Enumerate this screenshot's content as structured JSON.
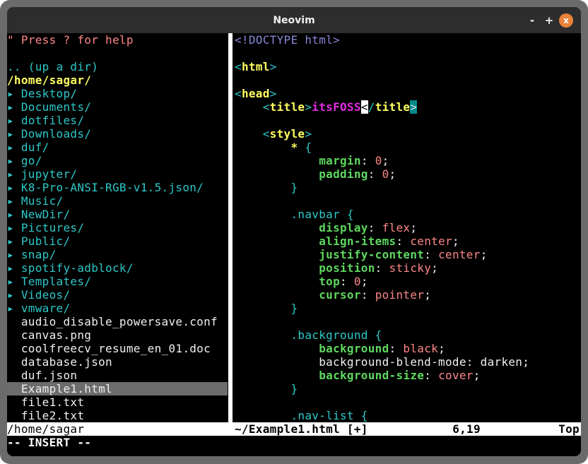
{
  "window": {
    "title": "Neovim",
    "buttons": {
      "minimize": "-",
      "maximize": "+",
      "close": "x"
    },
    "close_color": "#e9823a"
  },
  "tree": {
    "rows": [
      {
        "t": "\" Press ? for help",
        "c": "pink"
      },
      {
        "t": "",
        "c": "plain"
      },
      {
        "t": ".. (up a dir)",
        "c": "cyan"
      },
      {
        "t": "/home/sagar/",
        "c": "yellow"
      },
      {
        "t": "▸ Desktop/",
        "c": "cyan"
      },
      {
        "t": "▸ Documents/",
        "c": "cyan"
      },
      {
        "t": "▸ dotfiles/",
        "c": "cyan"
      },
      {
        "t": "▸ Downloads/",
        "c": "cyan"
      },
      {
        "t": "▸ duf/",
        "c": "cyan"
      },
      {
        "t": "▸ go/",
        "c": "cyan"
      },
      {
        "t": "▸ jupyter/",
        "c": "cyan"
      },
      {
        "t": "▸ K8-Pro-ANSI-RGB-v1.5.json/",
        "c": "cyan"
      },
      {
        "t": "▸ Music/",
        "c": "cyan"
      },
      {
        "t": "▸ NewDir/",
        "c": "cyan"
      },
      {
        "t": "▸ Pictures/",
        "c": "cyan"
      },
      {
        "t": "▸ Public/",
        "c": "cyan"
      },
      {
        "t": "▸ snap/",
        "c": "cyan"
      },
      {
        "t": "▸ spotify-adblock/",
        "c": "cyan"
      },
      {
        "t": "▸ Templates/",
        "c": "cyan"
      },
      {
        "t": "▸ Videos/",
        "c": "cyan"
      },
      {
        "t": "▸ vmware/",
        "c": "cyan"
      },
      {
        "t": "  audio_disable_powersave.conf",
        "c": "white"
      },
      {
        "t": "  canvas.png",
        "c": "white"
      },
      {
        "t": "  coolfreecv_resume_en_01.doc",
        "c": "white"
      },
      {
        "t": "  database.json",
        "c": "white"
      },
      {
        "t": "  duf.json",
        "c": "white"
      },
      {
        "t": "  Example1.html",
        "c": "white",
        "selected": true
      },
      {
        "t": "  file1.txt",
        "c": "white"
      },
      {
        "t": "  file2.txt",
        "c": "white"
      }
    ]
  },
  "editor": {
    "lines": [
      [
        {
          "t": "<!DOCTYPE html>",
          "c": "blue"
        }
      ],
      [],
      [
        {
          "t": "<",
          "c": "cyan"
        },
        {
          "t": "html",
          "c": "ytag"
        },
        {
          "t": ">",
          "c": "cyan"
        }
      ],
      [],
      [
        {
          "t": "<",
          "c": "cyan"
        },
        {
          "t": "head",
          "c": "ytag"
        },
        {
          "t": ">",
          "c": "cyan"
        }
      ],
      [
        {
          "t": "    ",
          "c": "plain"
        },
        {
          "t": "<",
          "c": "cyan"
        },
        {
          "t": "title",
          "c": "ytag"
        },
        {
          "t": ">",
          "c": "cyan"
        },
        {
          "t": "itsFOSS",
          "c": "mag"
        },
        {
          "t": "<",
          "c": "cyan",
          "b": "cur"
        },
        {
          "t": "/",
          "c": "cyan"
        },
        {
          "t": "title",
          "c": "ytag"
        },
        {
          "t": ">",
          "c": "cyan",
          "b": "match"
        }
      ],
      [],
      [
        {
          "t": "    ",
          "c": "plain"
        },
        {
          "t": "<",
          "c": "cyan"
        },
        {
          "t": "style",
          "c": "ytag"
        },
        {
          "t": ">",
          "c": "cyan"
        }
      ],
      [
        {
          "t": "        ",
          "c": "plain"
        },
        {
          "t": "*",
          "c": "ytag"
        },
        {
          "t": " {",
          "c": "cyan"
        }
      ],
      [
        {
          "t": "            ",
          "c": "plain"
        },
        {
          "t": "margin",
          "c": "green"
        },
        {
          "t": ": ",
          "c": "white"
        },
        {
          "t": "0",
          "c": "pink"
        },
        {
          "t": ";",
          "c": "white"
        }
      ],
      [
        {
          "t": "            ",
          "c": "plain"
        },
        {
          "t": "padding",
          "c": "green"
        },
        {
          "t": ": ",
          "c": "white"
        },
        {
          "t": "0",
          "c": "pink"
        },
        {
          "t": ";",
          "c": "white"
        }
      ],
      [
        {
          "t": "        }",
          "c": "cyan"
        }
      ],
      [],
      [
        {
          "t": "        .navbar {",
          "c": "cyan"
        }
      ],
      [
        {
          "t": "            ",
          "c": "plain"
        },
        {
          "t": "display",
          "c": "green"
        },
        {
          "t": ": ",
          "c": "white"
        },
        {
          "t": "flex",
          "c": "pink"
        },
        {
          "t": ";",
          "c": "white"
        }
      ],
      [
        {
          "t": "            ",
          "c": "plain"
        },
        {
          "t": "align-items",
          "c": "green"
        },
        {
          "t": ": ",
          "c": "white"
        },
        {
          "t": "center",
          "c": "pink"
        },
        {
          "t": ";",
          "c": "white"
        }
      ],
      [
        {
          "t": "            ",
          "c": "plain"
        },
        {
          "t": "justify-content",
          "c": "green"
        },
        {
          "t": ": ",
          "c": "white"
        },
        {
          "t": "center",
          "c": "pink"
        },
        {
          "t": ";",
          "c": "white"
        }
      ],
      [
        {
          "t": "            ",
          "c": "plain"
        },
        {
          "t": "position",
          "c": "green"
        },
        {
          "t": ": ",
          "c": "white"
        },
        {
          "t": "sticky",
          "c": "pink"
        },
        {
          "t": ";",
          "c": "white"
        }
      ],
      [
        {
          "t": "            ",
          "c": "plain"
        },
        {
          "t": "top",
          "c": "green"
        },
        {
          "t": ": ",
          "c": "white"
        },
        {
          "t": "0",
          "c": "pink"
        },
        {
          "t": ";",
          "c": "white"
        }
      ],
      [
        {
          "t": "            ",
          "c": "plain"
        },
        {
          "t": "cursor",
          "c": "green"
        },
        {
          "t": ": ",
          "c": "white"
        },
        {
          "t": "pointer",
          "c": "pink"
        },
        {
          "t": ";",
          "c": "white"
        }
      ],
      [
        {
          "t": "        }",
          "c": "cyan"
        }
      ],
      [],
      [
        {
          "t": "        .background {",
          "c": "cyan"
        }
      ],
      [
        {
          "t": "            ",
          "c": "plain"
        },
        {
          "t": "background",
          "c": "green"
        },
        {
          "t": ": ",
          "c": "white"
        },
        {
          "t": "black",
          "c": "pink"
        },
        {
          "t": ";",
          "c": "white"
        }
      ],
      [
        {
          "t": "            background-blend-mode: darken;",
          "c": "white"
        }
      ],
      [
        {
          "t": "            ",
          "c": "plain"
        },
        {
          "t": "background-size",
          "c": "green"
        },
        {
          "t": ": ",
          "c": "white"
        },
        {
          "t": "cover",
          "c": "pink"
        },
        {
          "t": ";",
          "c": "white"
        }
      ],
      [
        {
          "t": "        }",
          "c": "cyan"
        }
      ],
      [],
      [
        {
          "t": "        .nav-list {",
          "c": "cyan"
        }
      ]
    ]
  },
  "statusline": {
    "left_path": "/home/sagar",
    "file": "~/Example1.html [+]",
    "position": "6,19",
    "scroll": "Top"
  },
  "mode": "-- INSERT --"
}
